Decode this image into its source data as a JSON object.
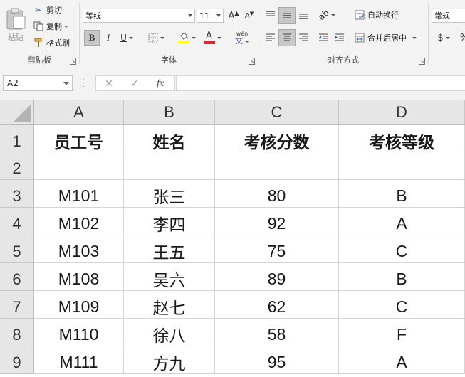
{
  "ribbon": {
    "clipboard": {
      "paste_label": "粘贴",
      "cut_label": "剪切",
      "copy_label": "复制",
      "format_painter_label": "格式刷",
      "group_label": "剪贴板"
    },
    "font": {
      "font_name": "等线",
      "font_size": "11",
      "bold": "B",
      "italic": "I",
      "underline": "U",
      "font_color_glyph": "A",
      "phonetic_glyph": "wén",
      "phonetic_glyph2": "文",
      "grow_glyph": "A",
      "shrink_glyph": "A",
      "group_label": "字体",
      "font_color": "#e0262b",
      "fill_color": "#ffff00"
    },
    "alignment": {
      "wrap_text_label": "自动换行",
      "merge_center_label": "合并后居中",
      "group_label": "对齐方式"
    },
    "number": {
      "format": "常规",
      "currency_glyph": "$",
      "percent_glyph": "%"
    }
  },
  "formula_bar": {
    "name_box": "A2",
    "cancel_glyph": "✕",
    "enter_glyph": "✓",
    "fx_glyph": "fx",
    "formula": ""
  },
  "sheet": {
    "columns": [
      "A",
      "B",
      "C",
      "D"
    ],
    "row_numbers": [
      "1",
      "2",
      "3",
      "4",
      "5",
      "6",
      "7",
      "8",
      "9"
    ],
    "rows": [
      [
        "员工号",
        "姓名",
        "考核分数",
        "考核等级"
      ],
      [
        "",
        "",
        "",
        ""
      ],
      [
        "M101",
        "张三",
        "80",
        "B"
      ],
      [
        "M102",
        "李四",
        "92",
        "A"
      ],
      [
        "M103",
        "王五",
        "75",
        "C"
      ],
      [
        "M108",
        "吴六",
        "89",
        "B"
      ],
      [
        "M109",
        "赵七",
        "62",
        "C"
      ],
      [
        "M110",
        "徐八",
        "58",
        "F"
      ],
      [
        "M111",
        "方九",
        "95",
        "A"
      ]
    ]
  }
}
